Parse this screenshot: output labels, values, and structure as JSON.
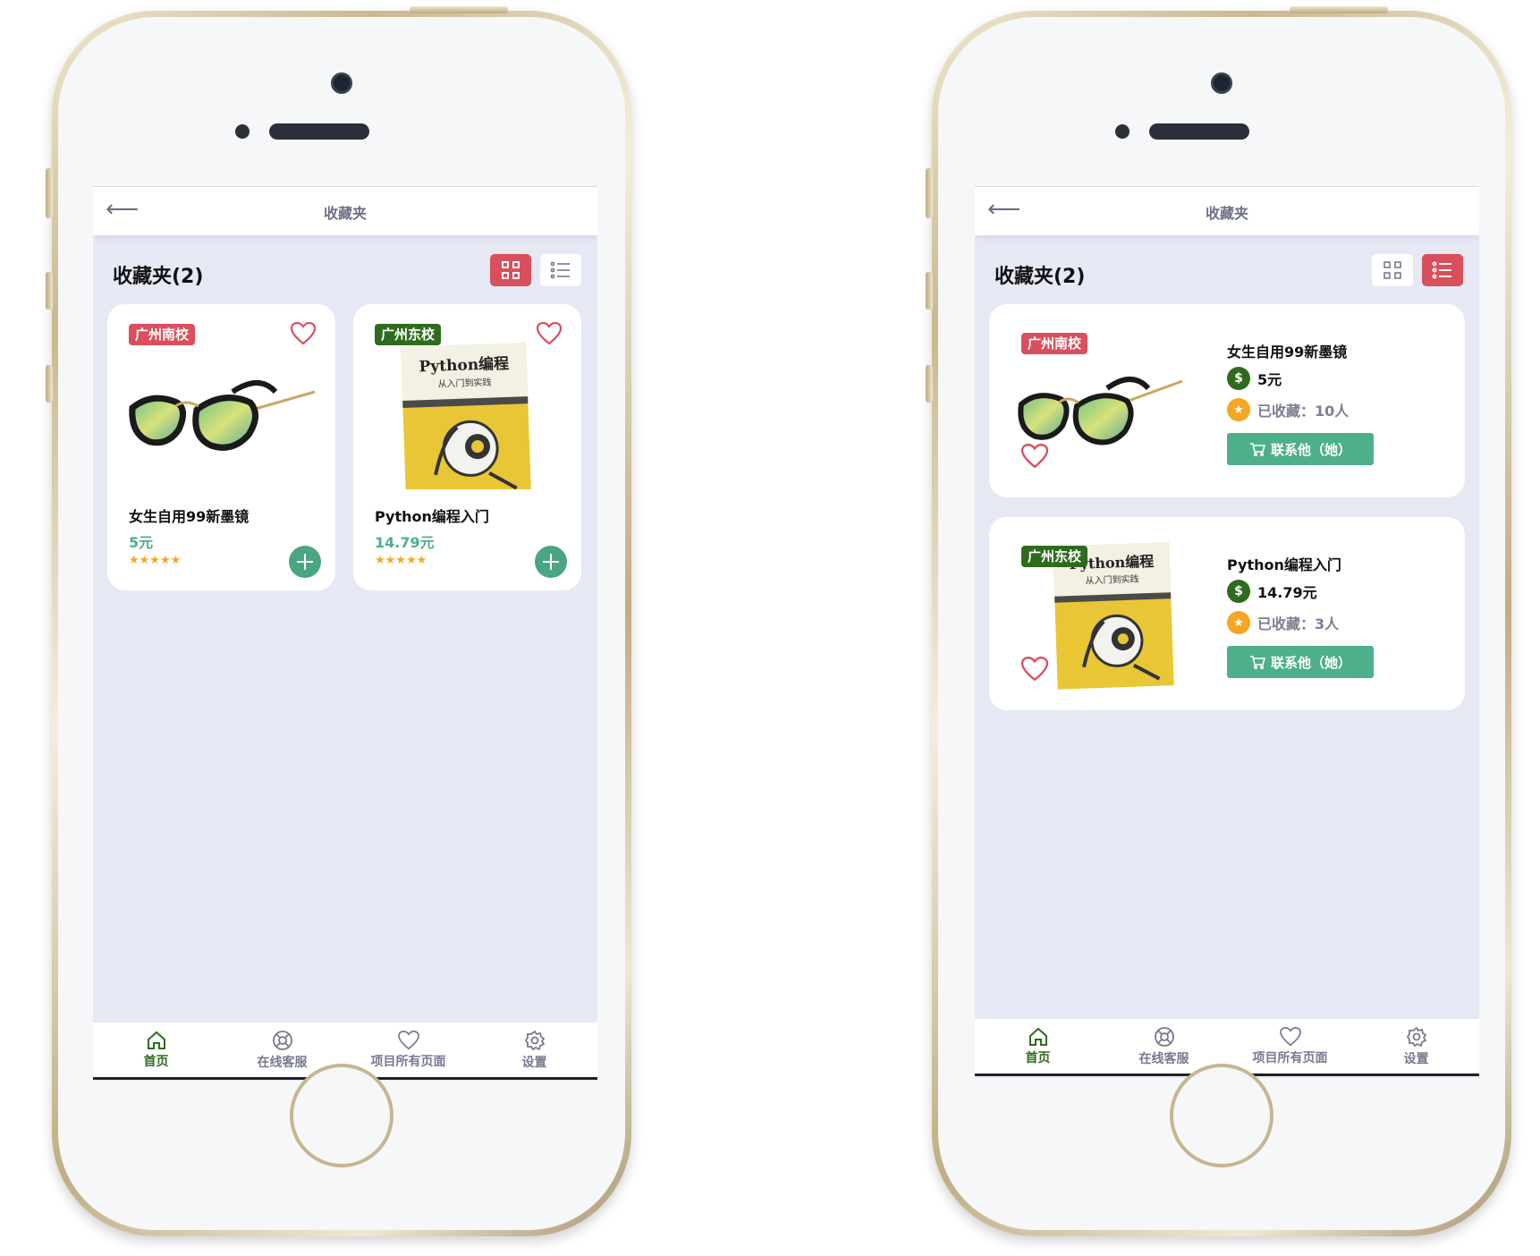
{
  "screens": [
    {
      "view": "grid",
      "nav_title": "收藏夹",
      "heading": "收藏夹(2)",
      "items": [
        {
          "campus": "广州南校",
          "campus_color": "#d94f5c",
          "title": "女生自用99新墨镜",
          "price": "5元",
          "rating": "★★★★★",
          "image": "sunglasses"
        },
        {
          "campus": "广州东校",
          "campus_color": "#2f6b1e",
          "title": "Python编程入门",
          "price": "14.79元",
          "rating": "★★★★★",
          "image": "python-book"
        }
      ],
      "tabs": [
        {
          "label": "首页",
          "icon": "home-icon",
          "active": true
        },
        {
          "label": "在线客服",
          "icon": "lifebuoy-icon",
          "active": false
        },
        {
          "label": "项目所有页面",
          "icon": "heart-icon",
          "active": false
        },
        {
          "label": "设置",
          "icon": "gear-icon",
          "active": false
        }
      ]
    },
    {
      "view": "list",
      "nav_title": "收藏夹",
      "heading": "收藏夹(2)",
      "items": [
        {
          "campus": "广州南校",
          "campus_color": "#d94f5c",
          "title": "女生自用99新墨镜",
          "price": "5元",
          "favorites": "已收藏：10人",
          "contact": "联系他（她）",
          "image": "sunglasses"
        },
        {
          "campus": "广州东校",
          "campus_color": "#2f6b1e",
          "title": "Python编程入门",
          "price": "14.79元",
          "favorites": "已收藏：3人",
          "contact": "联系他（她）",
          "image": "python-book"
        }
      ],
      "tabs": [
        {
          "label": "首页",
          "icon": "home-icon",
          "active": true
        },
        {
          "label": "在线客服",
          "icon": "lifebuoy-icon",
          "active": false
        },
        {
          "label": "项目所有页面",
          "icon": "heart-icon",
          "active": false
        },
        {
          "label": "设置",
          "icon": "gear-icon",
          "active": false
        }
      ]
    }
  ],
  "colors": {
    "accent_red": "#d94f5c",
    "accent_green": "#4db08a",
    "dark_green": "#2f6b1e",
    "star": "#f5a623",
    "screen_bg": "#e6e9f4"
  }
}
